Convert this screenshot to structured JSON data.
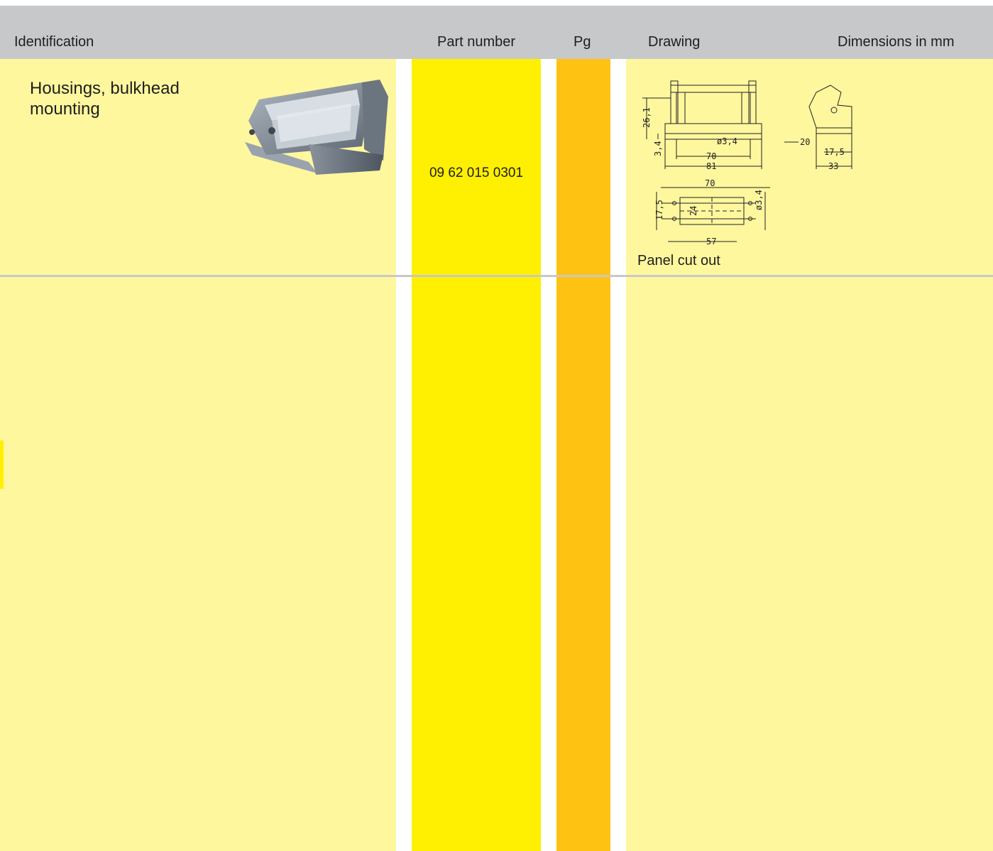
{
  "header": {
    "identification": "Identification",
    "part_number": "Part number",
    "pg": "Pg",
    "drawing": "Drawing",
    "dimensions": "Dimensions in mm"
  },
  "rows": [
    {
      "identification": "Housings, bulkhead mounting",
      "part_number": "09 62 015 0301",
      "pg": "",
      "drawing_note": "Panel cut out",
      "dimensions": {
        "front_height": "26,1",
        "flange": "3,4",
        "hole": "ø3,4",
        "inner_width": "70",
        "outer_width": "81",
        "side_offset": "20",
        "side_depth": "17,5",
        "side_width": "33",
        "cutout_width": "70",
        "cutout_height": "17,5",
        "cutout_inner": "24",
        "cutout_hole": "ø3,4",
        "cutout_length": "57"
      }
    }
  ],
  "colors": {
    "header": "#c7c8ca",
    "light_yellow": "#fff79e",
    "yellow": "#ffef00",
    "orange": "#fec212"
  }
}
